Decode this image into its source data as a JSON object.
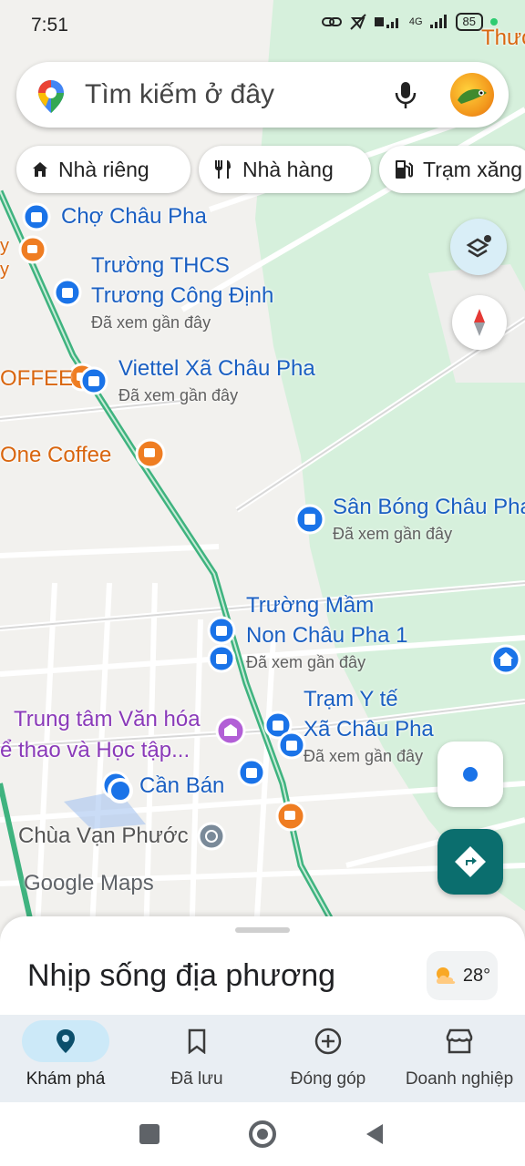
{
  "status_bar": {
    "time": "7:51",
    "battery": "85",
    "network": "4G"
  },
  "search": {
    "placeholder": "Tìm kiếm ở đây"
  },
  "chips": [
    {
      "label": "Nhà riêng",
      "icon": "home-icon"
    },
    {
      "label": "Nhà hàng",
      "icon": "restaurant-icon"
    },
    {
      "label": "Trạm xăng",
      "icon": "gas-station-icon"
    }
  ],
  "map": {
    "places": {
      "cho_chau_pha": "Chợ Châu Pha",
      "thcs_line1": "Trường THCS",
      "thcs_line2": "Trương Công Định",
      "viettel": "Viettel Xã Châu Pha",
      "coffee_left": "OFFEE",
      "one_coffee": "One Coffee",
      "san_bong": "Sân Bóng Châu Pha",
      "mam_non_line1": "Trường Mầm",
      "mam_non_line2": "Non Châu Pha 1",
      "tram_y_te_line1": "Trạm Y tế",
      "tram_y_te_line2": "Xã Châu Pha",
      "van_hoa_line1": "Trung tâm Văn hóa",
      "van_hoa_line2": "ể thao và Học tập...",
      "can_ban": "Cần Bán",
      "chua": "Chùa Vạn Phước",
      "top_right": "Thươ",
      "edge_y1": "y",
      "edge_y2": "y"
    },
    "recently_viewed": "Đã xem gần đây",
    "watermark": "Google Maps"
  },
  "sheet": {
    "title": "Nhịp sống địa phương",
    "temperature": "28°"
  },
  "tabs": [
    {
      "label": "Khám phá",
      "icon": "explore-pin-icon",
      "active": true
    },
    {
      "label": "Đã lưu",
      "icon": "bookmark-icon",
      "active": false
    },
    {
      "label": "Đóng góp",
      "icon": "add-circle-icon",
      "active": false
    },
    {
      "label": "Doanh nghiệp",
      "icon": "storefront-icon",
      "active": false
    }
  ],
  "colors": {
    "accent": "#1a73e8",
    "route": "#3fb37f",
    "park": "#d9f2e1",
    "directions": "#0b6e6e"
  }
}
